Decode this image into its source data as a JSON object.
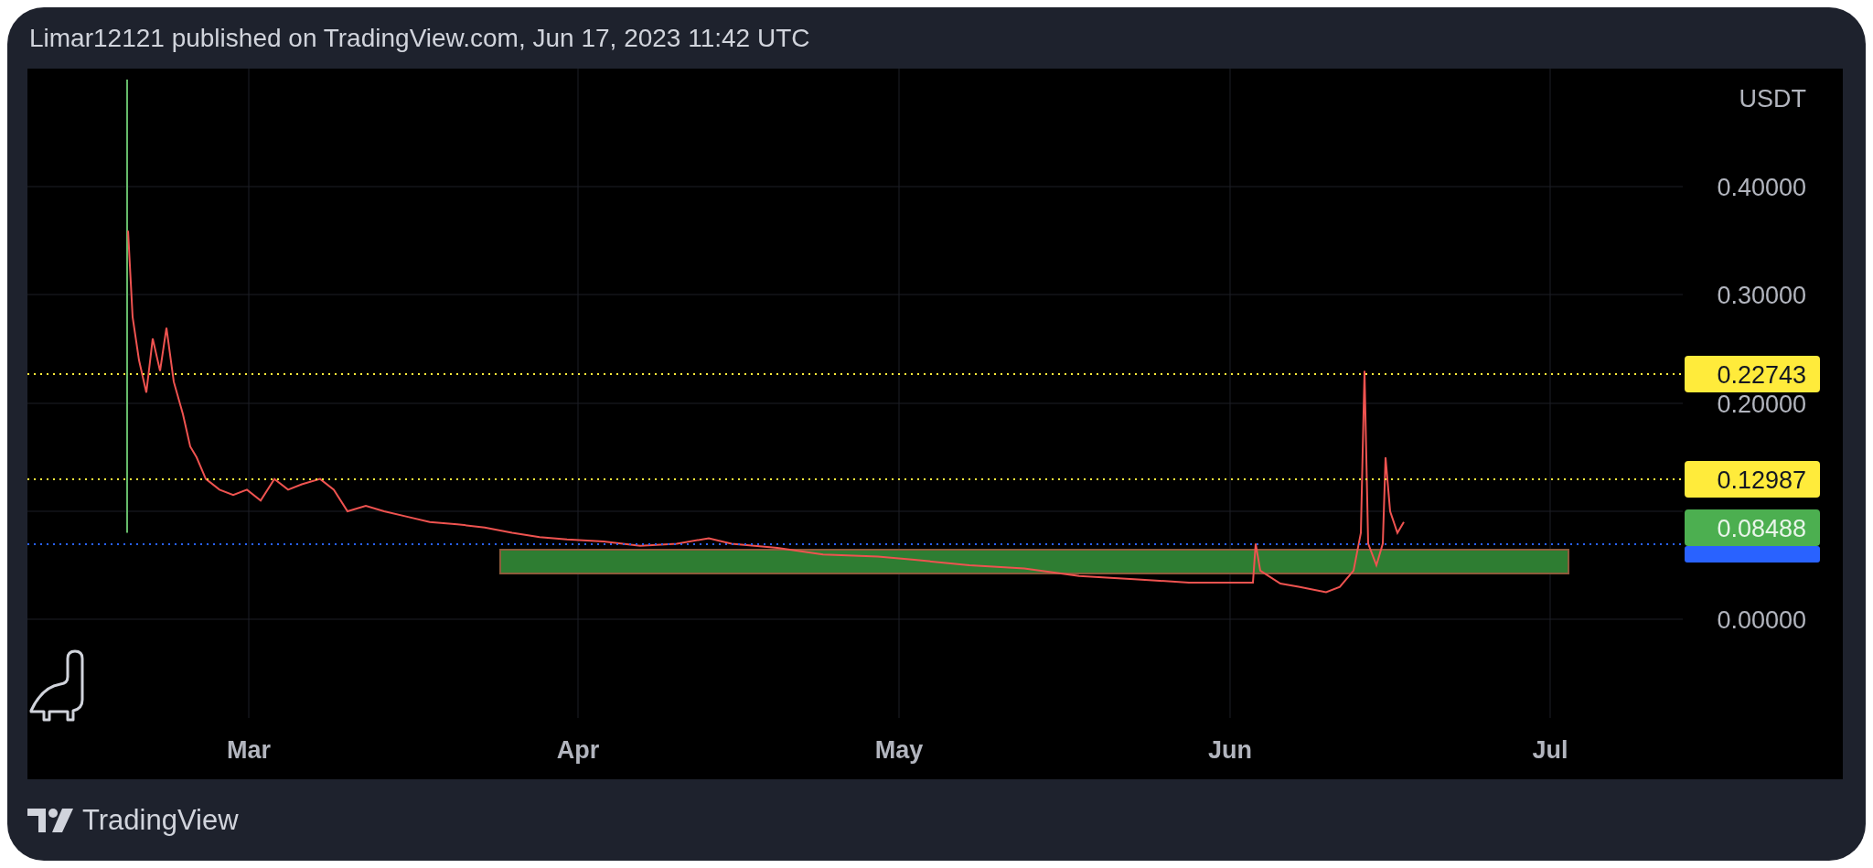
{
  "header": {
    "title": "Limar12121 published on TradingView.com, Jun 17, 2023 11:42 UTC"
  },
  "chart": {
    "currency": "USDT",
    "price_ticks": [
      "0.40000",
      "0.30000",
      "0.20000",
      "0.00000"
    ],
    "time_ticks": [
      "Mar",
      "Apr",
      "May",
      "Jun",
      "Jul"
    ],
    "price_lines": [
      {
        "label": "0.22743",
        "color": "#ffeb3b"
      },
      {
        "label": "0.12987",
        "color": "#ffeb3b"
      },
      {
        "color": "#2962ff"
      }
    ],
    "last_price": {
      "label": "0.08488",
      "color": "#4caf50"
    }
  },
  "footer": {
    "brand": "TradingView"
  }
}
